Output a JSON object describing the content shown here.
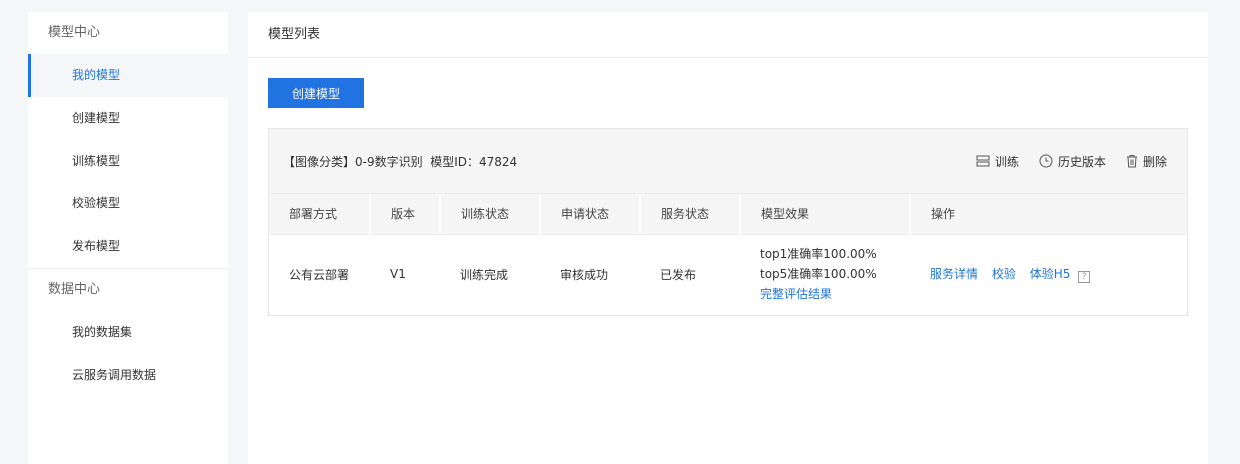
{
  "sidebar": {
    "groups": [
      {
        "label": "模型中心",
        "items": [
          {
            "label": "我的模型",
            "active": true
          },
          {
            "label": "创建模型",
            "active": false
          },
          {
            "label": "训练模型",
            "active": false
          },
          {
            "label": "校验模型",
            "active": false
          },
          {
            "label": "发布模型",
            "active": false
          }
        ]
      },
      {
        "label": "数据中心",
        "items": [
          {
            "label": "我的数据集",
            "active": false
          },
          {
            "label": "云服务调用数据",
            "active": false
          }
        ]
      }
    ]
  },
  "main": {
    "title": "模型列表",
    "create_button": "创建模型",
    "card": {
      "title": "【图像分类】0-9数字识别  模型ID：47824",
      "actions": [
        {
          "label": "训练",
          "icon": "server-icon"
        },
        {
          "label": "历史版本",
          "icon": "clock-icon"
        },
        {
          "label": "删除",
          "icon": "trash-icon"
        }
      ],
      "columns": [
        "部署方式",
        "版本",
        "训练状态",
        "申请状态",
        "服务状态",
        "模型效果",
        "操作"
      ],
      "rows": [
        {
          "deploy": "公有云部署",
          "version": "V1",
          "train_status": "训练完成",
          "apply_status": "审核成功",
          "service_status": "已发布",
          "effect": {
            "top1": "top1准确率100.00%",
            "top5": "top5准确率100.00%",
            "link": "完整评估结果"
          },
          "ops": [
            "服务详情",
            "校验",
            "体验H5"
          ],
          "help": "?"
        }
      ]
    }
  },
  "colors": {
    "accent": "#2073e0",
    "link": "#1f74d9",
    "background": "#f5f6f8"
  }
}
